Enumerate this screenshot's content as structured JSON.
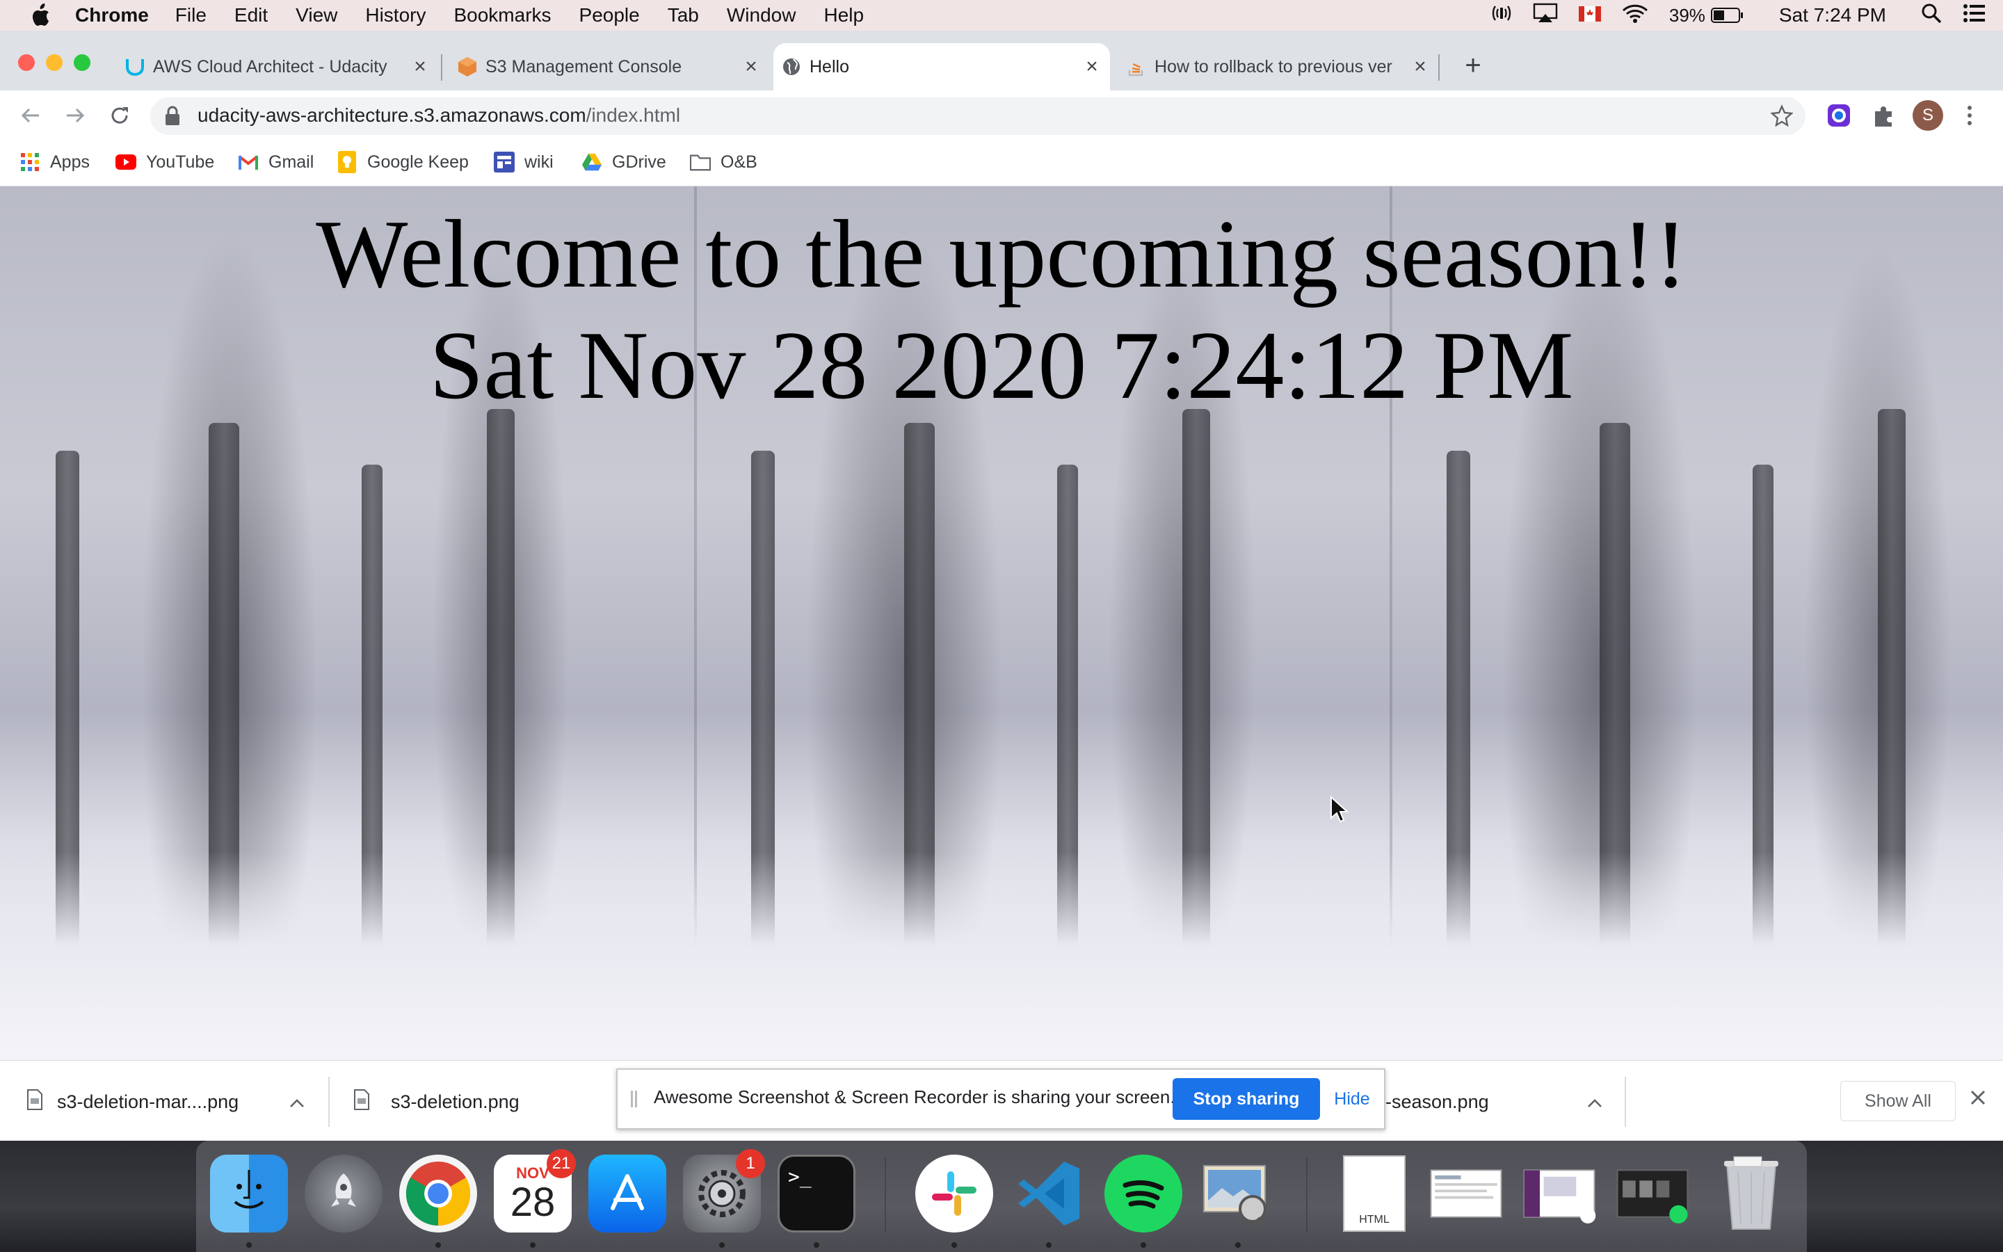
{
  "menubar": {
    "app": "Chrome",
    "items": [
      "File",
      "Edit",
      "View",
      "History",
      "Bookmarks",
      "People",
      "Tab",
      "Window",
      "Help"
    ],
    "battery": "39%",
    "clock": "Sat 7:24 PM"
  },
  "tabs": [
    {
      "label": "AWS Cloud Architect - Udacity",
      "icon": "udacity-icon"
    },
    {
      "label": "S3 Management Console",
      "icon": "aws-s3-icon"
    },
    {
      "label": "Hello",
      "icon": "globe-icon",
      "active": true
    },
    {
      "label": "How to rollback to previous ver",
      "icon": "stackoverflow-icon"
    }
  ],
  "address": {
    "host": "udacity-aws-architecture.s3.amazonaws.com",
    "path": "/index.html"
  },
  "profile_initial": "S",
  "bookmarks": [
    "Apps",
    "YouTube",
    "Gmail",
    "Google Keep",
    "wiki",
    "GDrive",
    "O&B"
  ],
  "page": {
    "heading": "Welcome to the upcoming season!!",
    "datetime": "Sat Nov 28 2020 7:24:12 PM"
  },
  "downloads": {
    "items": [
      "s3-deletion-mar....png",
      "s3-deletion.png",
      "-season.png"
    ],
    "show_all": "Show All"
  },
  "sharing": {
    "text": "Awesome Screenshot & Screen Recorder is sharing your screen.",
    "stop_label": "Stop sharing",
    "hide_label": "Hide"
  },
  "dock": {
    "calendar_month": "NOV",
    "calendar_day": "28",
    "calendar_badge": "21",
    "settings_badge": "1",
    "html_file_label": "HTML",
    "terminal_prompt": ">_"
  },
  "colors": {
    "accent": "#1a73e8",
    "menubar_bg": "#f1e4e4",
    "tabstrip_bg": "#dee1e6"
  }
}
